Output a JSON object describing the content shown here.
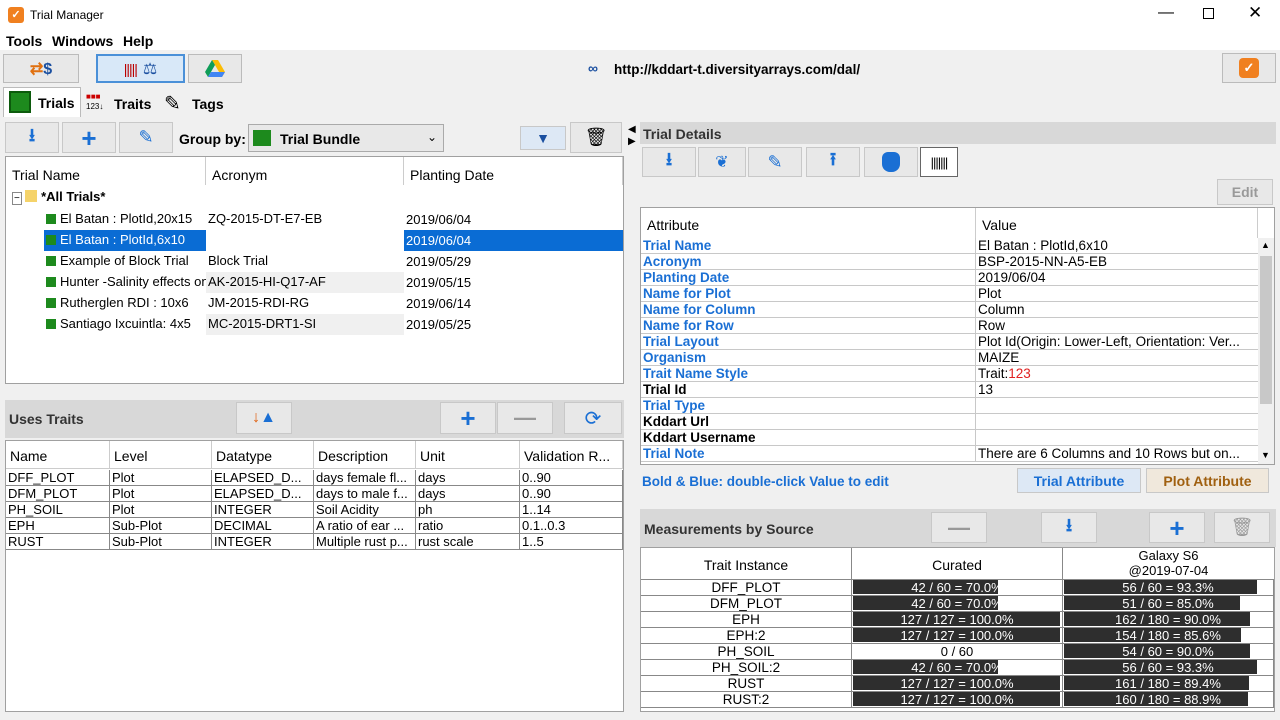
{
  "window": {
    "title": "Trial Manager"
  },
  "menu": [
    "Tools",
    "Windows",
    "Help"
  ],
  "url": "http://kddart-t.diversityarrays.com/dal/",
  "tabs": [
    "Trials",
    "Traits",
    "Tags"
  ],
  "group_by": {
    "label": "Group by:",
    "value": "Trial Bundle"
  },
  "trials": {
    "columns": [
      "Trial Name",
      "Acronym",
      "Planting Date"
    ],
    "root": "*All Trials*",
    "rows": [
      {
        "name": "El Batan : PlotId,20x15",
        "acronym": "ZQ-2015-DT-E7-EB",
        "date": "2019/06/04"
      },
      {
        "name": "El Batan : PlotId,6x10",
        "acronym": "",
        "date": "2019/06/04"
      },
      {
        "name": "Example of Block Trial",
        "acronym": "Block Trial",
        "date": "2019/05/29"
      },
      {
        "name": "Hunter -Salinity effects on",
        "acronym": "AK-2015-HI-Q17-AF",
        "date": "2019/05/15"
      },
      {
        "name": "Rutherglen RDI : 10x6",
        "acronym": "JM-2015-RDI-RG",
        "date": "2019/06/14"
      },
      {
        "name": "Santiago Ixcuintla: 4x5",
        "acronym": "MC-2015-DRT1-SI",
        "date": "2019/05/25"
      }
    ]
  },
  "uses_traits": {
    "title": "Uses Traits",
    "columns": [
      "Name",
      "Level",
      "Datatype",
      "Description",
      "Unit",
      "Validation R..."
    ],
    "rows": [
      [
        "DFF_PLOT",
        "Plot",
        "ELAPSED_D...",
        "days female fl...",
        "days",
        "0..90"
      ],
      [
        "DFM_PLOT",
        "Plot",
        "ELAPSED_D...",
        "days to male f...",
        "days",
        "0..90"
      ],
      [
        "PH_SOIL",
        "Plot",
        "INTEGER",
        "Soil Acidity",
        "ph",
        "1..14"
      ],
      [
        "EPH",
        "Sub-Plot",
        "DECIMAL",
        "A ratio of ear ...",
        "ratio",
        "0.1..0.3"
      ],
      [
        "RUST",
        "Sub-Plot",
        "INTEGER",
        "Multiple rust p...",
        "rust scale",
        "1..5"
      ]
    ]
  },
  "trial_details": {
    "title": "Trial Details",
    "edit_label": "Edit",
    "columns": [
      "Attribute",
      "Value"
    ],
    "rows": [
      {
        "attr": "Trial Name",
        "value": "El Batan : PlotId,6x10",
        "blue": true
      },
      {
        "attr": "Acronym",
        "value": "BSP-2015-NN-A5-EB",
        "blue": true
      },
      {
        "attr": "Planting Date",
        "value": "2019/06/04",
        "blue": true
      },
      {
        "attr": "Name for Plot",
        "value": "Plot",
        "blue": true
      },
      {
        "attr": "Name for Column",
        "value": "Column",
        "blue": true
      },
      {
        "attr": "Name for Row",
        "value": "Row",
        "blue": true
      },
      {
        "attr": "Trial Layout",
        "value": "Plot Id(Origin: Lower-Left, Orientation: Ver...",
        "blue": true
      },
      {
        "attr": "Organism",
        "value": "MAIZE",
        "blue": true
      },
      {
        "attr": "Trait Name Style",
        "value": "Trait:",
        "value_suffix": "123",
        "blue": true
      },
      {
        "attr": "Trial Id",
        "value": "13",
        "blue": false
      },
      {
        "attr": "Trial Type",
        "value": "",
        "blue": true
      },
      {
        "attr": "Kddart Url",
        "value": "",
        "blue": false
      },
      {
        "attr": "Kddart Username",
        "value": "",
        "blue": false
      },
      {
        "attr": "Trial Note",
        "value": "There are 6 Columns and 10 Rows but on...",
        "blue": true
      }
    ],
    "hint": "Bold & Blue: double-click Value to edit",
    "trial_attribute_btn": "Trial Attribute",
    "plot_attribute_btn": "Plot Attribute"
  },
  "measurements": {
    "title": "Measurements by Source",
    "columns": [
      "Trait Instance",
      "Curated",
      "Galaxy S6",
      "@2019-07-04"
    ],
    "rows": [
      {
        "trait": "DFF_PLOT",
        "c_text": "42 / 60 = 70.0%",
        "c_frac": 0.7,
        "g_text": "56 / 60 = 93.3%",
        "g_frac": 0.933
      },
      {
        "trait": "DFM_PLOT",
        "c_text": "42 / 60 = 70.0%",
        "c_frac": 0.7,
        "g_text": "51 / 60 = 85.0%",
        "g_frac": 0.85
      },
      {
        "trait": "EPH",
        "c_text": "127 / 127 = 100.0%",
        "c_frac": 1.0,
        "g_text": "162 / 180 = 90.0%",
        "g_frac": 0.9
      },
      {
        "trait": "EPH:2",
        "c_text": "127 / 127 = 100.0%",
        "c_frac": 1.0,
        "g_text": "154 / 180 = 85.6%",
        "g_frac": 0.856
      },
      {
        "trait": "PH_SOIL",
        "c_text": "0 / 60",
        "c_frac": 0.0,
        "g_text": "54 / 60 = 90.0%",
        "g_frac": 0.9
      },
      {
        "trait": "PH_SOIL:2",
        "c_text": "42 / 60 = 70.0%",
        "c_frac": 0.7,
        "g_text": "56 / 60 = 93.3%",
        "g_frac": 0.933
      },
      {
        "trait": "RUST",
        "c_text": "127 / 127 = 100.0%",
        "c_frac": 1.0,
        "g_text": "161 / 180 = 89.4%",
        "g_frac": 0.894
      },
      {
        "trait": "RUST:2",
        "c_text": "127 / 127 = 100.0%",
        "c_frac": 1.0,
        "g_text": "160 / 180 = 88.9%",
        "g_frac": 0.889
      }
    ]
  },
  "colors": {
    "accent_blue": "#1a6fd4",
    "selection": "#0a6cd4",
    "bar": "#2e2e2e",
    "plot_attr_text": "#a06010"
  }
}
